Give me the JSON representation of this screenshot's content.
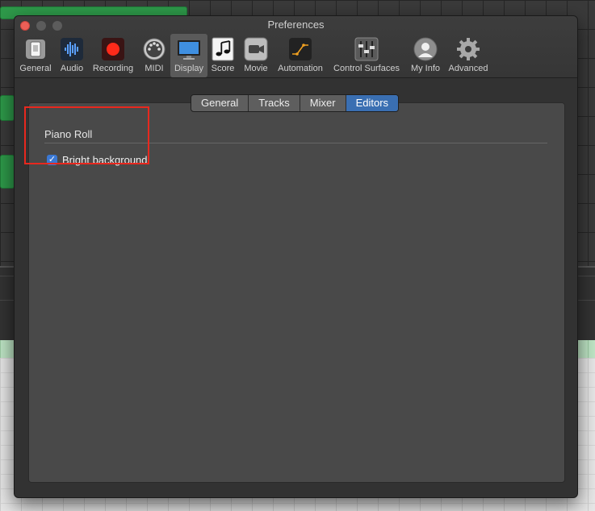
{
  "window": {
    "title": "Preferences"
  },
  "toolbar": {
    "items": [
      {
        "label": "General",
        "icon": "general-icon"
      },
      {
        "label": "Audio",
        "icon": "audio-icon"
      },
      {
        "label": "Recording",
        "icon": "recording-icon"
      },
      {
        "label": "MIDI",
        "icon": "midi-icon"
      },
      {
        "label": "Display",
        "icon": "display-icon",
        "selected": true
      },
      {
        "label": "Score",
        "icon": "score-icon"
      },
      {
        "label": "Movie",
        "icon": "movie-icon"
      },
      {
        "label": "Automation",
        "icon": "automation-icon"
      },
      {
        "label": "Control Surfaces",
        "icon": "control-surfaces-icon"
      },
      {
        "label": "My Info",
        "icon": "my-info-icon"
      },
      {
        "label": "Advanced",
        "icon": "advanced-icon"
      }
    ]
  },
  "tabs": [
    {
      "label": "General",
      "active": false
    },
    {
      "label": "Tracks",
      "active": false
    },
    {
      "label": "Mixer",
      "active": false
    },
    {
      "label": "Editors",
      "active": true
    }
  ],
  "section": {
    "title": "Piano Roll",
    "options": [
      {
        "label": "Bright background",
        "checked": true
      }
    ]
  },
  "colors": {
    "accent": "#3a6fb2",
    "checkbox": "#3a78d4",
    "highlight": "#e8281e"
  }
}
